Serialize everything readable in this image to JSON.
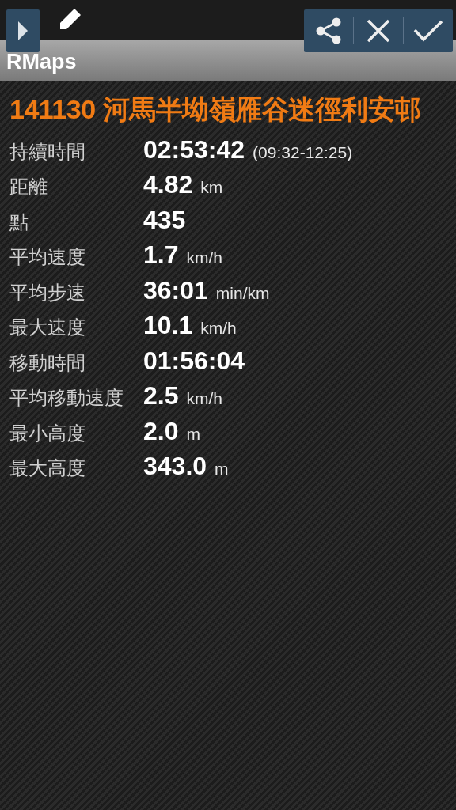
{
  "app_bar": {
    "title": "RMaps"
  },
  "track_title": "141130 河馬半坳嶺雁谷迷徑利安邨",
  "stats": [
    {
      "label": "持續時間",
      "value": "02:53:42",
      "unit": "(09:32-12:25)"
    },
    {
      "label": "距離",
      "value": "4.82",
      "unit": "km"
    },
    {
      "label": "點",
      "value": "435"
    },
    {
      "label": "平均速度",
      "value": "1.7",
      "unit": "km/h"
    },
    {
      "label": "平均步速",
      "value": "36:01",
      "unit": "min/km"
    },
    {
      "label": "最大速度",
      "value": "10.1",
      "unit": "km/h"
    },
    {
      "label": "移動時間",
      "value": "01:56:04"
    },
    {
      "label": "平均移動速度",
      "value": "2.5",
      "unit": "km/h"
    },
    {
      "label": "最小高度",
      "value": "2.0",
      "unit": "m"
    },
    {
      "label": "最大高度",
      "value": "343.0",
      "unit": "m"
    }
  ]
}
